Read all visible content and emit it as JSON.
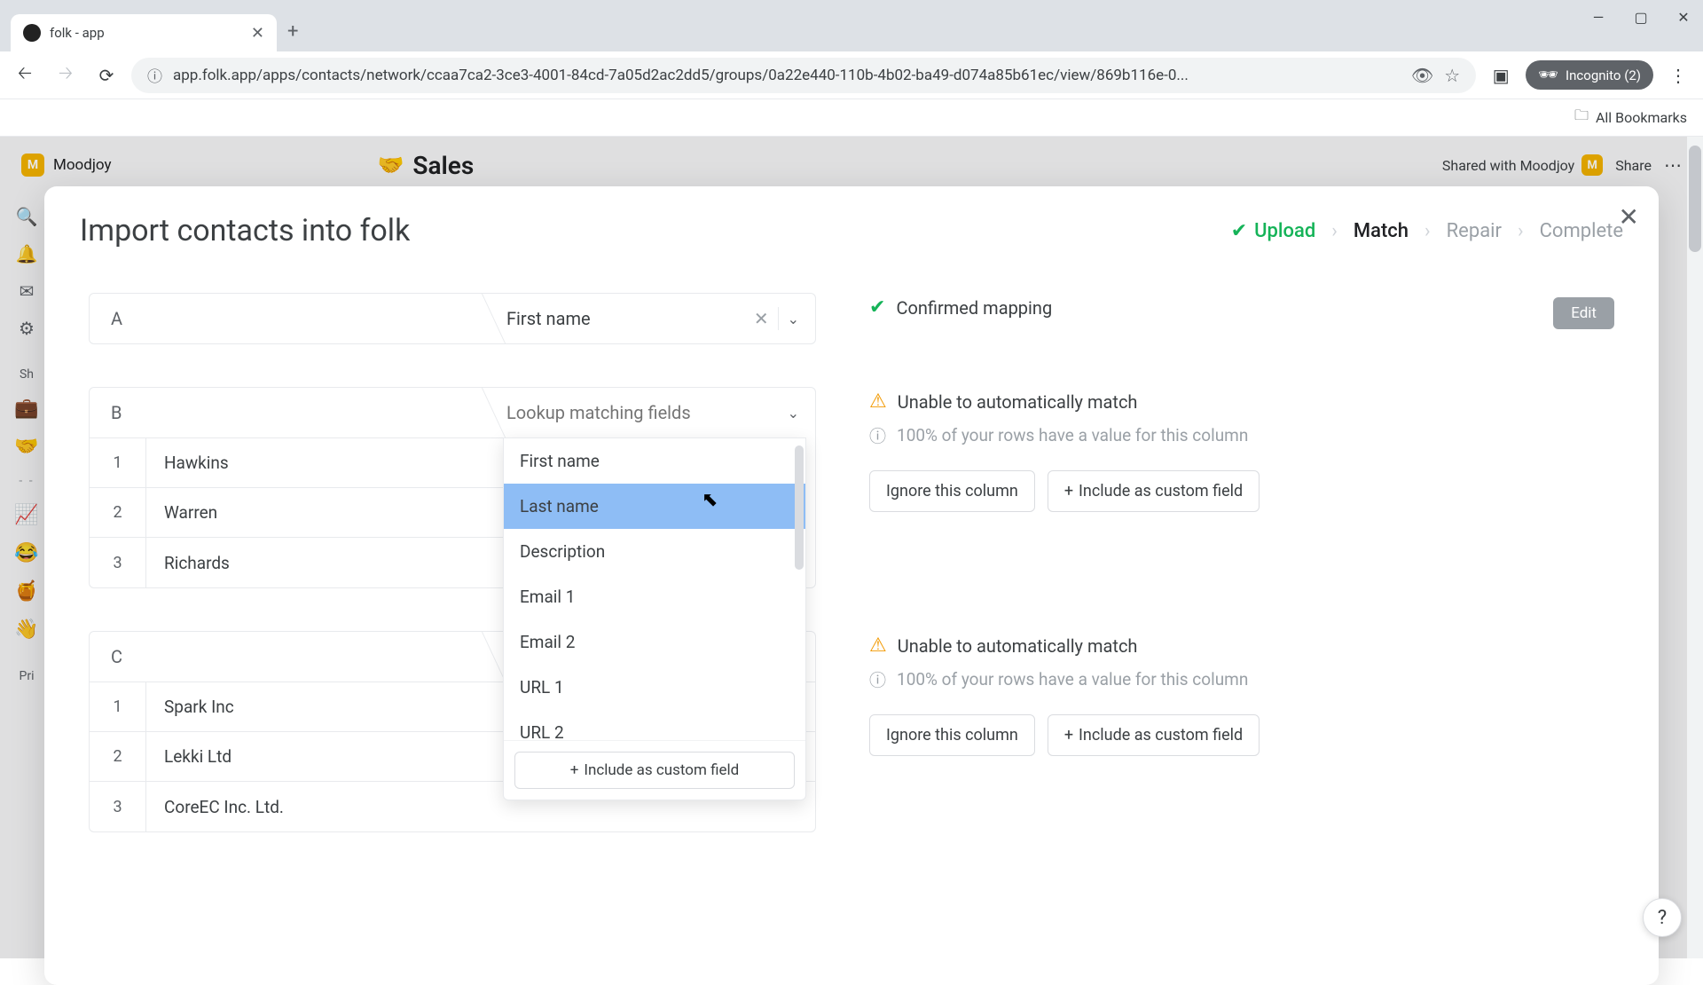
{
  "browser": {
    "tab_title": "folk - app",
    "url": "app.folk.app/apps/contacts/network/ccaa7ca2-3ce3-4001-84cd-7a05d2ac2dd5/groups/0a22e440-110b-4b02-ba49-d074a85b61ec/view/869b116e-0...",
    "incognito_label": "Incognito (2)",
    "all_bookmarks": "All Bookmarks"
  },
  "app": {
    "workspace_initial": "M",
    "workspace_name": "Moodjoy",
    "page_emoji": "🤝",
    "page_title": "Sales",
    "shared_label": "Shared with Moodjoy",
    "share_btn": "Share",
    "sidebar_shared_label": "Sh",
    "sidebar_pri_label": "Pri"
  },
  "modal": {
    "title": "Import contacts into folk",
    "steps": {
      "upload": "Upload",
      "match": "Match",
      "repair": "Repair",
      "complete": "Complete"
    },
    "field_lookup_placeholder": "Lookup matching fields",
    "confirmed_text": "Confirmed mapping",
    "edit_btn": "Edit",
    "unable_match": "Unable to automatically match",
    "info_100": "100% of your rows have a value for this column",
    "ignore_btn": "Ignore this column",
    "include_btn": "Include as custom field",
    "columns": {
      "A": {
        "letter": "A",
        "mapped_to": "First name"
      },
      "B": {
        "letter": "B",
        "rows": [
          "Hawkins",
          "Warren",
          "Richards"
        ]
      },
      "C": {
        "letter": "C",
        "rows": [
          "Spark Inc",
          "Lekki Ltd",
          "CoreEC Inc. Ltd."
        ]
      }
    },
    "dropdown_options": [
      "First name",
      "Last name",
      "Description",
      "Email 1",
      "Email 2",
      "URL 1",
      "URL 2"
    ]
  }
}
